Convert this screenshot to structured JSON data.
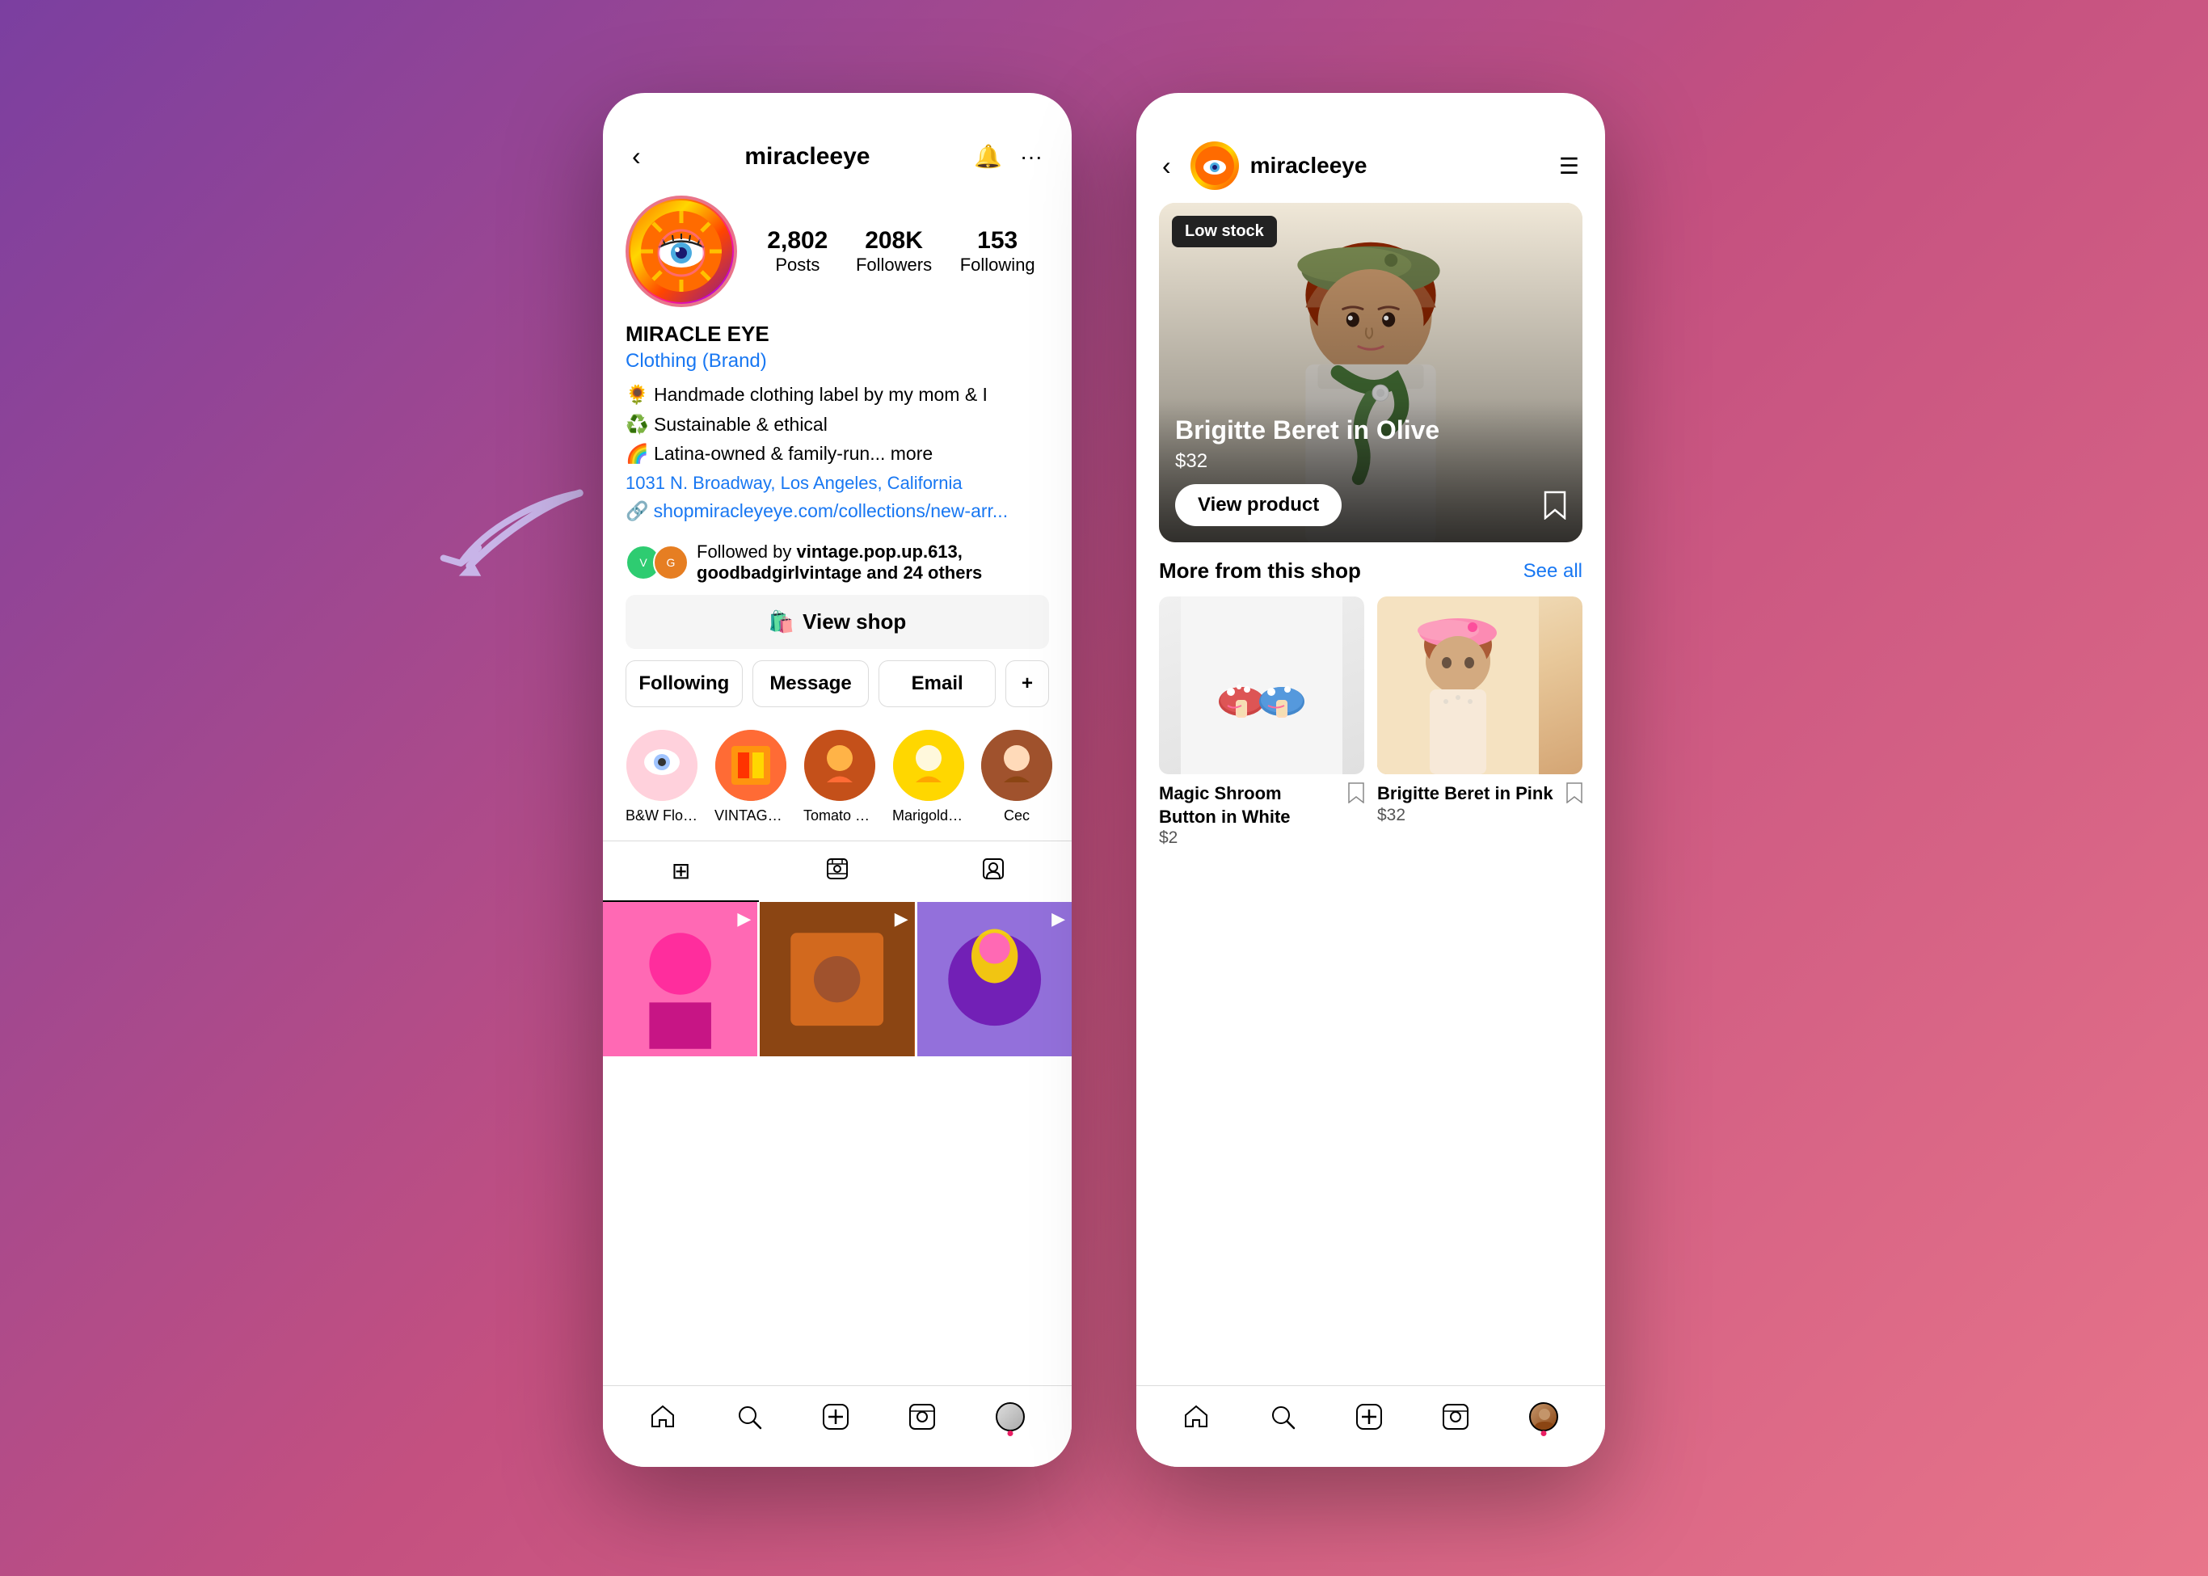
{
  "background": {
    "gradient": "linear-gradient(135deg, #7B3FA0 0%, #C45080 50%, #E8758A 100%)"
  },
  "left_phone": {
    "header": {
      "back_icon": "‹",
      "title": "miracleeye",
      "bell_icon": "🔔",
      "more_icon": "···"
    },
    "profile": {
      "posts_count": "2,802",
      "posts_label": "Posts",
      "followers_count": "208K",
      "followers_label": "Followers",
      "following_count": "153",
      "following_label": "Following"
    },
    "bio": {
      "name": "MIRACLE EYE",
      "category": "Clothing (Brand)",
      "line1": "🌻 Handmade clothing label by my mom & I",
      "line2": "♻️ Sustainable & ethical",
      "line3": "🌈 Latina-owned & family-run... more",
      "address": "1031 N. Broadway, Los Angeles, California",
      "link_icon": "🔗",
      "link_text": "shopmiracleyeye.com/collections/new-arr..."
    },
    "followed_by": {
      "text_before": "Followed by",
      "names": "vintage.pop.up.613, goodbadgirlvintage and 24 others"
    },
    "view_shop": {
      "icon": "🛍️",
      "label": "View shop"
    },
    "buttons": {
      "following": "Following",
      "message": "Message",
      "email": "Email",
      "add_icon": "+"
    },
    "stories": [
      {
        "label": "B&W Flower"
      },
      {
        "label": "VINTAGE S..."
      },
      {
        "label": "Tomato Stri..."
      },
      {
        "label": "Marigold BTS"
      },
      {
        "label": "Cec"
      }
    ],
    "tabs": {
      "grid_icon": "⊞",
      "video_icon": "▶",
      "person_icon": "👤"
    },
    "nav": {
      "home": "⌂",
      "search": "🔍",
      "add": "⊕",
      "reels": "▶",
      "profile": "👤"
    }
  },
  "right_phone": {
    "header": {
      "back_icon": "‹",
      "username": "miracleeye",
      "menu_icon": "☰"
    },
    "product": {
      "badge": "Low stock",
      "title": "Brigitte Beret in Olive",
      "price": "$32",
      "view_btn": "View product"
    },
    "more_section": {
      "title": "More from this shop",
      "see_all": "See all"
    },
    "items": [
      {
        "name": "Magic Shroom Button in White",
        "price": "$2"
      },
      {
        "name": "Brigitte Beret in Pink",
        "price": "$32"
      }
    ],
    "nav": {
      "home": "⌂",
      "search": "🔍",
      "add": "⊕",
      "reels": "▶",
      "profile": "👤"
    }
  },
  "arrow": {
    "color": "#C8B4E8"
  }
}
